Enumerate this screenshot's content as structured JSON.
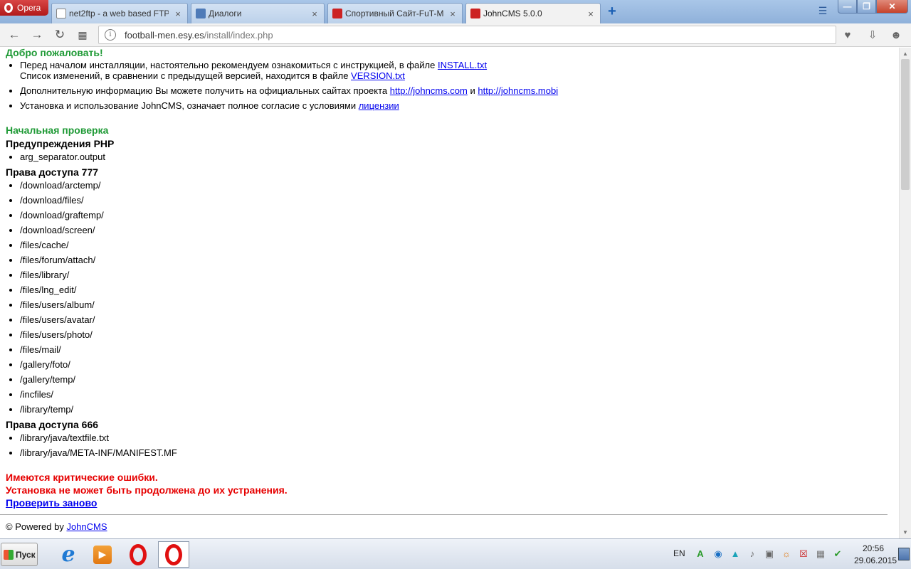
{
  "browser": {
    "menu_label": "Opera",
    "tabs": [
      {
        "title": "net2ftp - a web based FTP",
        "close": "×"
      },
      {
        "title": "Диалоги",
        "close": "×"
      },
      {
        "title": "Спортивный Сайт-FuT-M",
        "close": "×"
      },
      {
        "title": "JohnCMS 5.0.0",
        "close": "×"
      }
    ],
    "new_tab": "+",
    "address": {
      "domain": "football-men.esy.es",
      "path": "/install/index.php"
    }
  },
  "page": {
    "welcome": "Добро пожаловать!",
    "intro": [
      {
        "line1": "Перед началом инсталляции, настоятельно рекомендуем ознакомиться с инструкцией, в файле ",
        "link1": "INSTALL.txt",
        "line2": "Список изменений, в сравнении с предыдущей версией, находится в файле ",
        "link2": "VERSION.txt"
      },
      {
        "text": "Дополнительную информацию Вы можете получить на официальных сайтах проекта ",
        "link1": "http://johncms.com",
        "mid": " и ",
        "link2": "http://johncms.mobi"
      },
      {
        "text": "Установка и использование JohnCMS, означает полное согласие с условиями ",
        "link": "лицензии"
      }
    ],
    "check_title": "Начальная проверка",
    "php_warnings_title": "Предупреждения PHP",
    "php_warnings": [
      "arg_separator.output"
    ],
    "perm777_title": "Права доступа 777",
    "perm777": [
      "/download/arctemp/",
      "/download/files/",
      "/download/graftemp/",
      "/download/screen/",
      "/files/cache/",
      "/files/forum/attach/",
      "/files/library/",
      "/files/lng_edit/",
      "/files/users/album/",
      "/files/users/avatar/",
      "/files/users/photo/",
      "/files/mail/",
      "/gallery/foto/",
      "/gallery/temp/",
      "/incfiles/",
      "/library/temp/"
    ],
    "perm666_title": "Права доступа 666",
    "perm666": [
      "/library/java/textfile.txt",
      "/library/java/META-INF/MANIFEST.MF"
    ],
    "error1": "Имеются критические ошибки.",
    "error2": "Установка не может быть продолжена до их устранения.",
    "retry": "Проверить заново",
    "footer_text": "© Powered by ",
    "footer_link": "JohnCMS"
  },
  "taskbar": {
    "start": "Пуск",
    "lang": "EN",
    "time": "20:56",
    "date": "29.06.2015"
  },
  "colors": {
    "accent_green": "#1f9a36",
    "error_red": "#e60000",
    "link_blue": "#0000ee"
  }
}
